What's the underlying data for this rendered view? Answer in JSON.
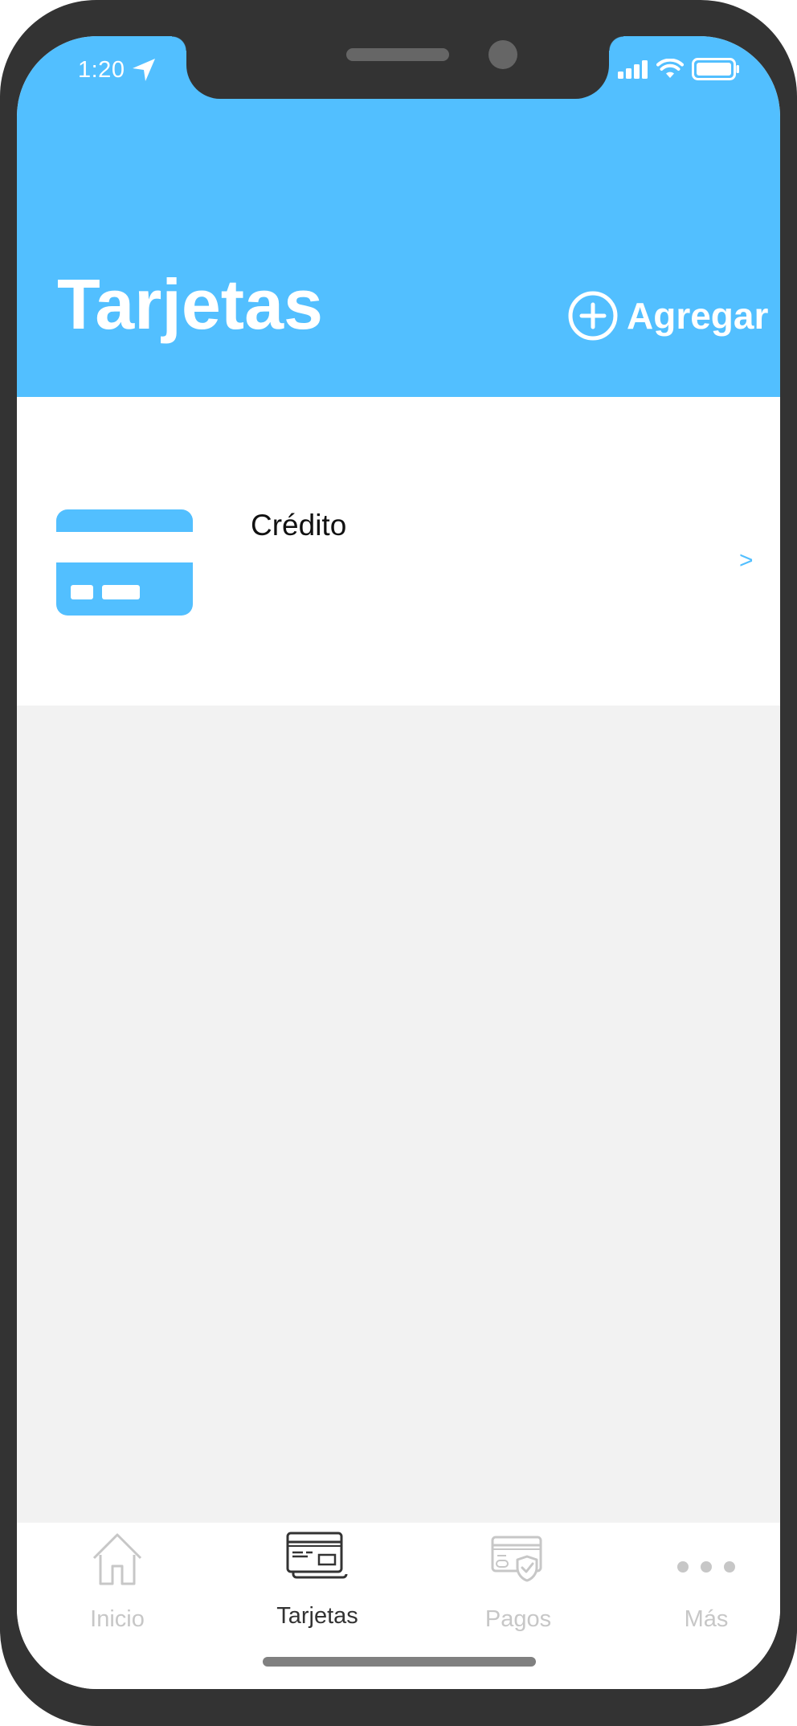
{
  "status_bar": {
    "time": "1:20"
  },
  "header": {
    "title": "Tarjetas",
    "add_label": "Agregar"
  },
  "cards": [
    {
      "label": "Crédito",
      "chevron": ">"
    }
  ],
  "tabbar": {
    "items": [
      {
        "label": "Inicio",
        "icon": "home-icon",
        "active": false
      },
      {
        "label": "Tarjetas",
        "icon": "cards-icon",
        "active": true
      },
      {
        "label": "Pagos",
        "icon": "payments-shield-icon",
        "active": false
      },
      {
        "label": "Más",
        "icon": "more-dots-icon",
        "active": false
      }
    ]
  },
  "colors": {
    "accent": "#52bfff",
    "frame": "#333333",
    "background": "#f2f2f2",
    "tab_inactive": "#c7c7c7",
    "tab_active": "#333333"
  }
}
